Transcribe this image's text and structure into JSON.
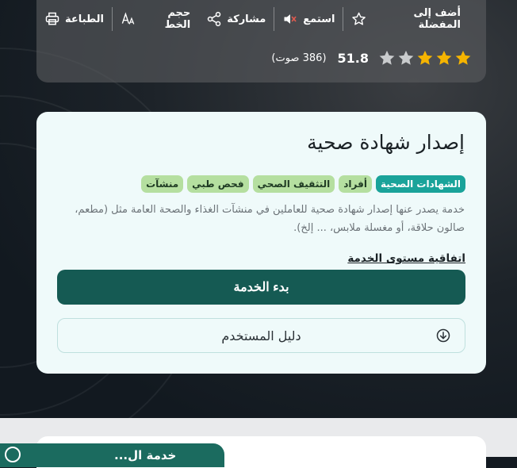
{
  "toolbar": {
    "favorite": "أضف إلى المفضلة",
    "listen": "استمع",
    "share": "مشاركة",
    "font_size": "حجم الخط",
    "print": "الطباعة"
  },
  "rating": {
    "stars_filled": 3,
    "stars_total": 5,
    "value": "51.8",
    "votes": "(386 صوت)"
  },
  "service": {
    "title": "إصدار شهادة صحية",
    "tags": [
      "الشهادات الصحية",
      "أفراد",
      "التثقيف الصحي",
      "فحص طبي",
      "منشآت"
    ],
    "description": "خدمة يصدر عنها إصدار شهادة صحية للعاملين في منشآت الغذاء والصحة العامة مثل (مطعم، صالون حلاقة، أو مغسلة ملابس، ... إلخ).",
    "sla_link": "اتفاقية مستوى الخدمة",
    "start_button": "بدء الخدمة",
    "guide_button": "دليل المستخدم"
  },
  "floating": {
    "label": "خدمة ال..."
  },
  "colors": {
    "primary": "#155a53",
    "tag_primary": "#1aa39a",
    "tag": "#b5dfa0",
    "star_filled": "#f5b400",
    "star_empty": "#c9cbcd"
  }
}
